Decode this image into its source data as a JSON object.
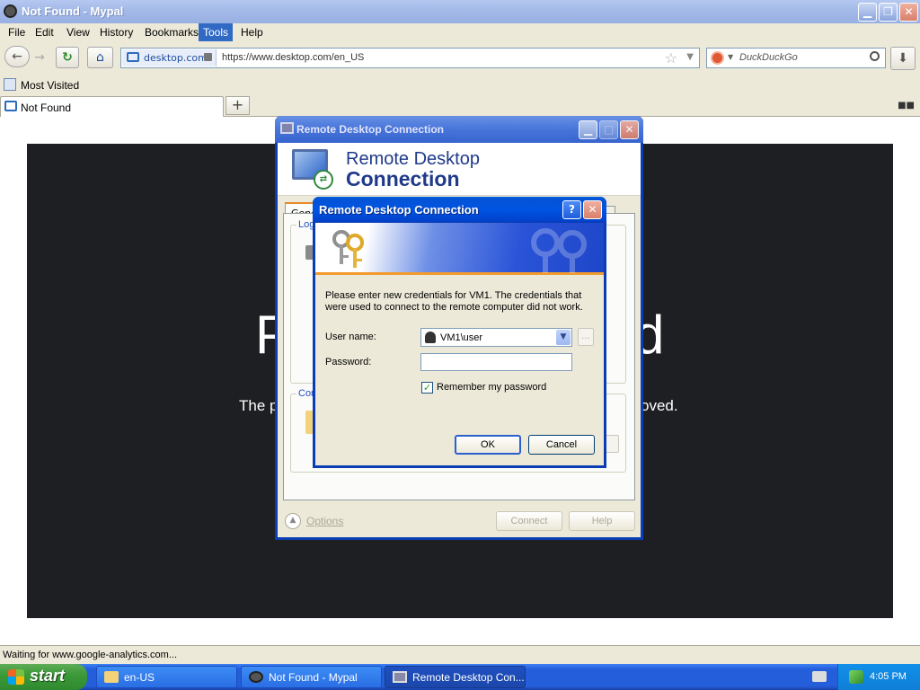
{
  "browser": {
    "window_title": "Not Found - Mypal",
    "menu": [
      "File",
      "Edit",
      "View",
      "History",
      "Bookmarks",
      "Tools",
      "Help"
    ],
    "active_menu": "Tools",
    "site_identity": "desktop.com",
    "url": "https://www.desktop.com/en_US",
    "search_placeholder": "DuckDuckGo",
    "bookmark": "Most Visited",
    "tab_title": "Not Found",
    "status_text": "Waiting for www.google-analytics.com...",
    "page_heading_left": "P",
    "page_heading_right": "d",
    "page_subtext_left": "The p",
    "page_subtext_right": "oved."
  },
  "rdc_window": {
    "title": "Remote Desktop Connection",
    "header_line1": "Remote Desktop",
    "header_line2": "Connection",
    "tab_general": "Gene",
    "tab_advanced": "d",
    "group_logon": "Log",
    "group_connection": "Con",
    "options_label": "Options",
    "connect_label": "Connect",
    "help_label": "Help"
  },
  "credentials_dialog": {
    "title": "Remote Desktop Connection",
    "message": "Please enter new credentials for VM1. The credentials that were used to connect to the remote computer did not work.",
    "username_label": "User name:",
    "username_value": "VM1\\user",
    "password_label": "Password:",
    "password_value": "",
    "remember_label": "Remember my password",
    "remember_checked": true,
    "ok_label": "OK",
    "cancel_label": "Cancel"
  },
  "taskbar": {
    "start_label": "start",
    "items": [
      {
        "label": "en-US"
      },
      {
        "label": "Not Found - Mypal"
      },
      {
        "label": "Remote Desktop Con..."
      }
    ],
    "active_item": "Remote Desktop Con...",
    "clock": "4:05 PM"
  },
  "colors": {
    "xp_title_blue": "#0054e3",
    "taskbar_blue": "#245edb",
    "start_green": "#3c9a3a",
    "page_dark": "#1e1f22",
    "dialog_face": "#ece9d8"
  }
}
